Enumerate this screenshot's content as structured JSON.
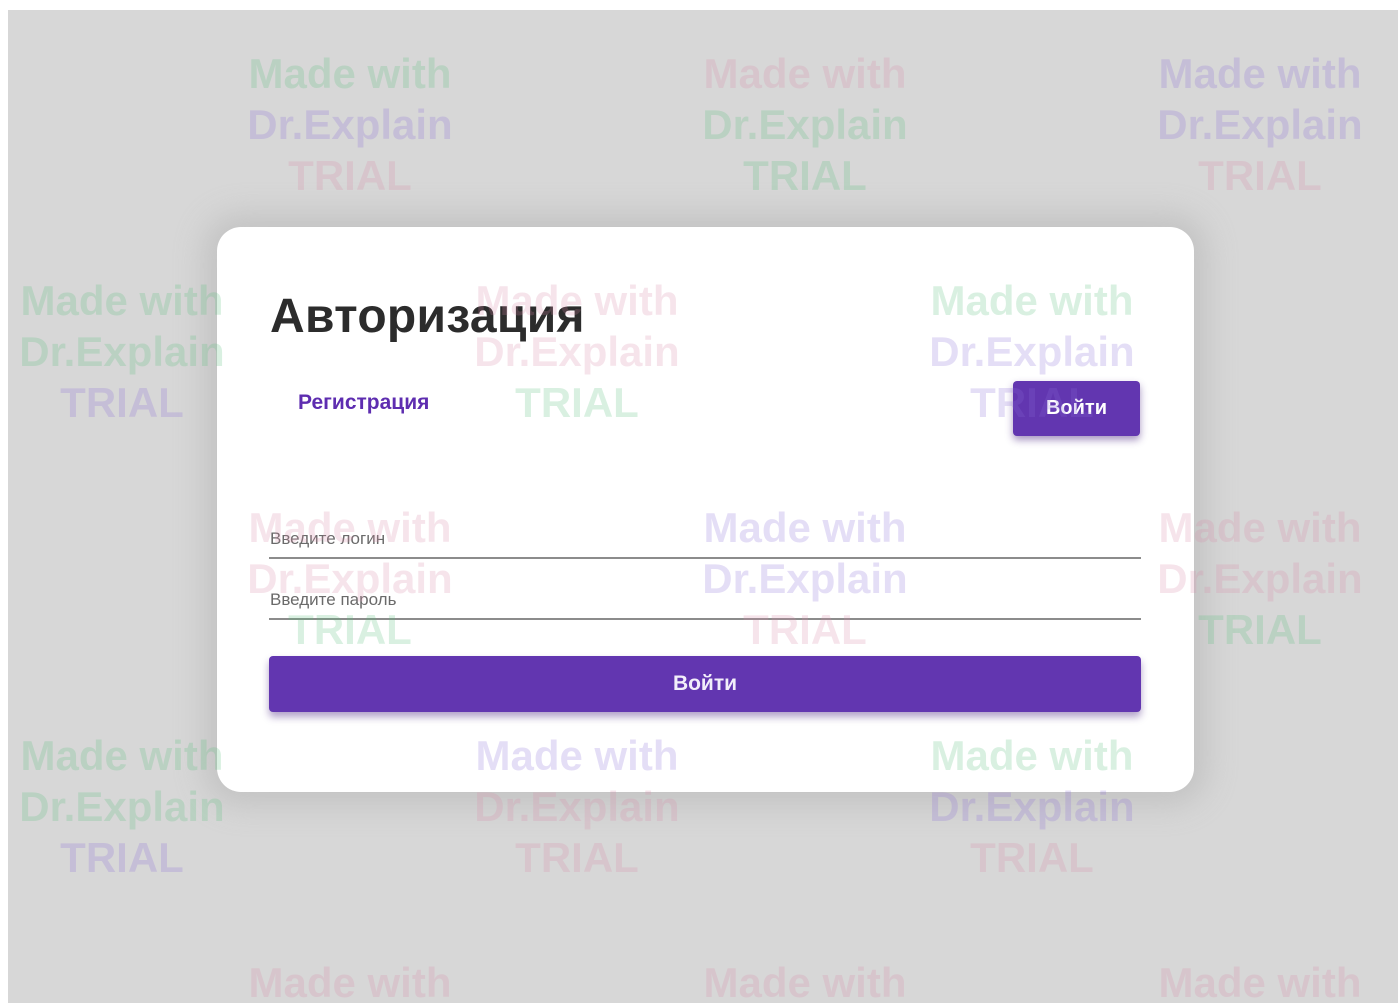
{
  "auth": {
    "title": "Авторизация",
    "register_tab_label": "Регистрация",
    "login_tab_label": "Войти",
    "login_placeholder": "Введите логин",
    "password_placeholder": "Введите пароль",
    "submit_label": "Войти"
  },
  "watermark": {
    "line1": "Made with",
    "line2": "Dr.Explain",
    "line3": "TRIAL"
  },
  "colors": {
    "accent": "#6236b0",
    "backdrop": "#d7d7d7",
    "card": "#ffffff"
  }
}
